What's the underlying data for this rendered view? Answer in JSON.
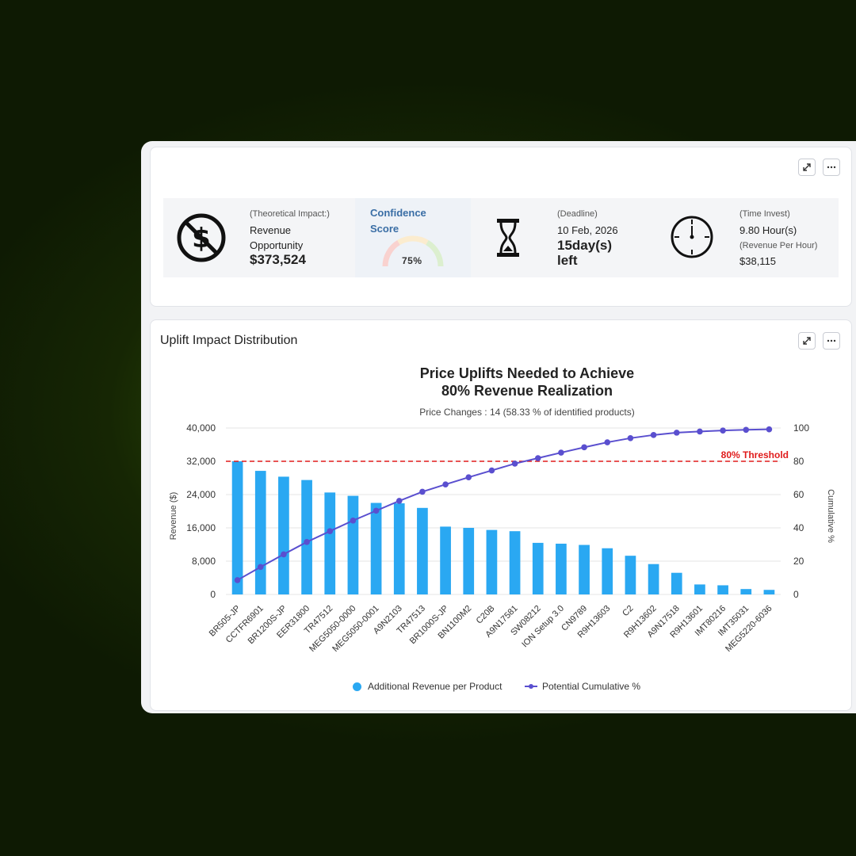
{
  "impact": {
    "label": "(Theoretical Impact:)",
    "line1": "Revenue",
    "line2": "Opportunity",
    "value": "$373,524",
    "icon": "no-dollar-icon"
  },
  "confidence": {
    "title_line1": "Confidence",
    "title_line2": "Score",
    "value": "75%",
    "level": 0.75
  },
  "deadline": {
    "label": "(Deadline)",
    "date": "10 Feb, 2026",
    "days_line1": "15day(s)",
    "days_line2": "left",
    "icon": "hourglass-icon"
  },
  "time": {
    "label": "(Time Invest)",
    "hours": "9.80 Hour(s)",
    "rate_label": "(Revenue Per Hour)",
    "rate": "$38,115",
    "icon": "clock-icon"
  },
  "chart_card": {
    "title": "Uplift Impact Distribution"
  },
  "chart_data": {
    "type": "bar",
    "title_line1": "Price Uplifts Needed to Achieve",
    "title_line2": "80% Revenue Realization",
    "subtitle": "Price Changes : 14 (58.33 % of identified products)",
    "ylabel": "Revenue ($)",
    "y2label": "Cumulative %",
    "ylim": [
      0,
      40000
    ],
    "y2lim": [
      0,
      100
    ],
    "yticks": [
      "0",
      "8,000",
      "16,000",
      "24,000",
      "32,000",
      "40,000"
    ],
    "y2ticks": [
      "0",
      "20",
      "40",
      "60",
      "80",
      "100"
    ],
    "threshold_label": "80% Threshold",
    "threshold_value": 80,
    "categories": [
      "BR505-JP",
      "CCTFR6901",
      "BR1200S-JP",
      "EER31800",
      "TR47512",
      "MEG5050-0000",
      "MEG5050-0001",
      "A9N2103",
      "TR47513",
      "BR1000S-JP",
      "BN1100M2",
      "C20B",
      "A9N17581",
      "SW08212",
      "ION Setup 3.0",
      "CN9789",
      "R9H13603",
      "C2",
      "R9H13602",
      "A9N17518",
      "R9H13601",
      "IMT80216",
      "IMT35031",
      "MEG5220-6036"
    ],
    "series": [
      {
        "name": "Additional Revenue per Product",
        "type": "bar",
        "color": "#2aa8f2",
        "values": [
          32000,
          29700,
          28300,
          27500,
          24500,
          23700,
          22000,
          21900,
          20800,
          16300,
          16000,
          15500,
          15200,
          12400,
          12200,
          11900,
          11100,
          9300,
          7300,
          5200,
          2400,
          2200,
          1300,
          1100
        ]
      },
      {
        "name": "Potential Cumulative %",
        "type": "line",
        "color": "#5a4fcf",
        "values": [
          8.6,
          16.5,
          24.1,
          31.5,
          38.0,
          44.4,
          50.3,
          56.2,
          61.7,
          66.1,
          70.4,
          74.5,
          78.6,
          81.9,
          85.2,
          88.4,
          91.4,
          93.9,
          95.8,
          97.2,
          97.9,
          98.5,
          98.9,
          99.2
        ]
      }
    ],
    "colors": {
      "threshold": "#e01b1b",
      "grid": "#e6e6e6"
    }
  }
}
